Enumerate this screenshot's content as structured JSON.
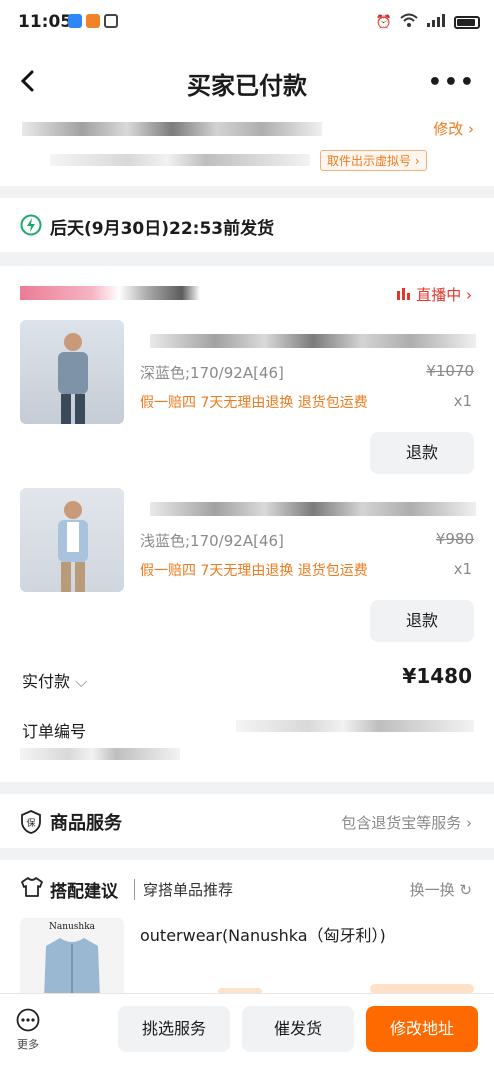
{
  "status_bar": {
    "time": "11:05",
    "battery": "battery-icon"
  },
  "nav": {
    "title": "买家已付款",
    "back_icon": "chevron-left-icon",
    "more_icon": "more-icon"
  },
  "address": {
    "edit_label": "修改 ›",
    "virtual_number_label": "取件出示虚拟号 ›"
  },
  "shipping": {
    "icon": "lightning-icon",
    "text": "后天(9月30日)22:53前发货"
  },
  "shop": {
    "live_label": "直播中 ›",
    "live_icon": "live-bars-icon"
  },
  "products": [
    {
      "spec": "深蓝色;170/92A[46]",
      "promo": "假一赔四  7天无理由退换  退货包运费",
      "price": "¥1070",
      "qty": "x1",
      "refund_label": "退款"
    },
    {
      "spec": "浅蓝色;170/92A[46]",
      "promo": "假一赔四  7天无理由退换  退货包运费",
      "price": "¥980",
      "qty": "x1",
      "refund_label": "退款"
    }
  ],
  "payment": {
    "label": "实付款",
    "amount": "¥1480"
  },
  "order": {
    "number_label": "订单编号"
  },
  "service": {
    "title": "商品服务",
    "detail": "包含退货宝等服务 ›"
  },
  "suggestion": {
    "title": "搭配建议",
    "subtitle": "穿搭单品推荐",
    "refresh": "换一换",
    "item_title": "outerwear(Nanushka（匈牙利）)",
    "brand": "Nanushka"
  },
  "bottom_bar": {
    "more_label": "更多",
    "btn1": "挑选服务",
    "btn2": "催发货",
    "btn3": "修改地址"
  },
  "colors": {
    "accent": "#ff6a00",
    "orange_text": "#ef7b1e",
    "live_red": "#e5352d"
  }
}
